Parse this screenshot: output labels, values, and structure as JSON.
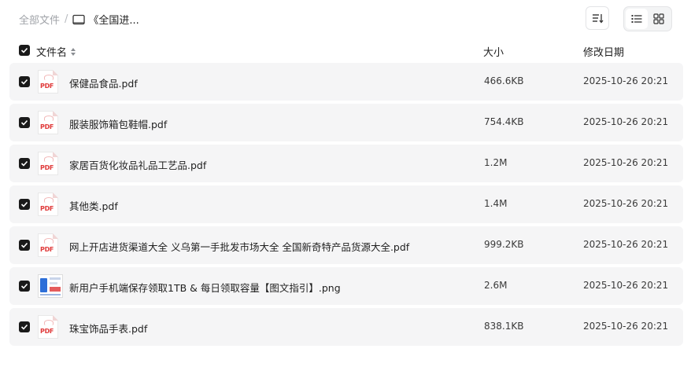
{
  "breadcrumb": {
    "root": "全部文件",
    "separator": "/",
    "current": "《全国进..."
  },
  "header": {
    "name": "文件名",
    "size": "大小",
    "date": "修改日期"
  },
  "toolbar": {
    "sort_icon": "sort-icon",
    "list_view_icon": "list-view-icon",
    "grid_view_icon": "grid-view-icon",
    "active_view": "list"
  },
  "colors": {
    "checkbox": "#1a1a1a",
    "row_bg": "#f5f5f6",
    "pdf_red": "#e03a3a"
  },
  "files": [
    {
      "name": "保健品食品.pdf",
      "size": "466.6KB",
      "date": "2025-10-26 20:21",
      "type": "pdf",
      "checked": true
    },
    {
      "name": "服装服饰箱包鞋帽.pdf",
      "size": "754.4KB",
      "date": "2025-10-26 20:21",
      "type": "pdf",
      "checked": true
    },
    {
      "name": "家居百货化妆品礼品工艺品.pdf",
      "size": "1.2M",
      "date": "2025-10-26 20:21",
      "type": "pdf",
      "checked": true
    },
    {
      "name": "其他类.pdf",
      "size": "1.4M",
      "date": "2025-10-26 20:21",
      "type": "pdf",
      "checked": true
    },
    {
      "name": "网上开店进货渠道大全 义乌第一手批发市场大全 全国新奇特产品货源大全.pdf",
      "size": "999.2KB",
      "date": "2025-10-26 20:21",
      "type": "pdf",
      "checked": true
    },
    {
      "name": "新用户手机端保存领取1TB & 每日领取容量【图文指引】.png",
      "size": "2.6M",
      "date": "2025-10-26 20:21",
      "type": "png",
      "checked": true
    },
    {
      "name": "珠宝饰品手表.pdf",
      "size": "838.1KB",
      "date": "2025-10-26 20:21",
      "type": "pdf",
      "checked": true
    }
  ]
}
